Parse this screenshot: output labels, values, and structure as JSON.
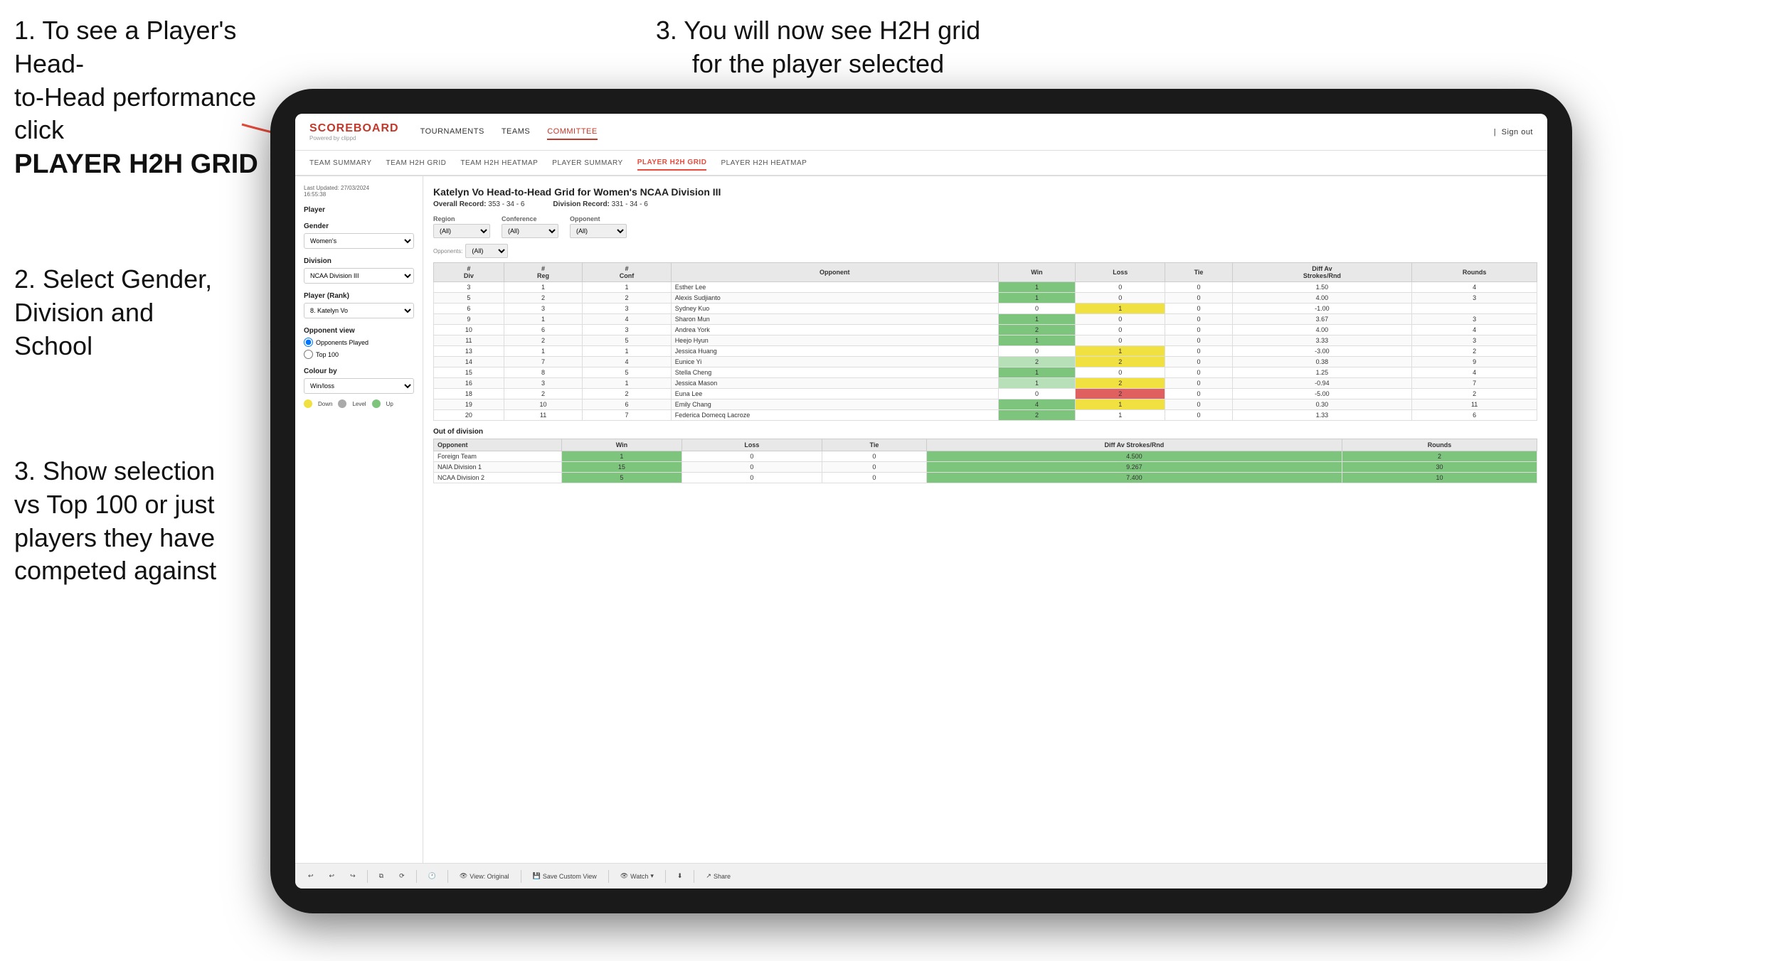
{
  "instructions": {
    "step1_line1": "1. To see a Player's Head-",
    "step1_line2": "to-Head performance click",
    "step1_bold": "PLAYER H2H GRID",
    "step3_top_line1": "3. You will now see H2H grid",
    "step3_top_line2": "for the player selected",
    "step2_line1": "2. Select Gender,",
    "step2_line2": "Division and",
    "step2_line3": "School",
    "step3_bot_line1": "3. Show selection",
    "step3_bot_line2": "vs Top 100 or just",
    "step3_bot_line3": "players they have",
    "step3_bot_line4": "competed against"
  },
  "nav": {
    "logo": "SCOREBOARD",
    "logo_sub": "Powered by clippd",
    "items": [
      "TOURNAMENTS",
      "TEAMS",
      "COMMITTEE"
    ],
    "active_item": "COMMITTEE",
    "sign_out": "Sign out"
  },
  "sub_nav": {
    "items": [
      "TEAM SUMMARY",
      "TEAM H2H GRID",
      "TEAM H2H HEATMAP",
      "PLAYER SUMMARY",
      "PLAYER H2H GRID",
      "PLAYER H2H HEATMAP"
    ],
    "active": "PLAYER H2H GRID"
  },
  "sidebar": {
    "last_updated": "Last Updated: 27/03/2024",
    "time": "16:55:38",
    "player_label": "Player",
    "gender_label": "Gender",
    "gender_value": "Women's",
    "division_label": "Division",
    "division_value": "NCAA Division III",
    "player_rank_label": "Player (Rank)",
    "player_rank_value": "8. Katelyn Vo",
    "opponent_view_label": "Opponent view",
    "radio1": "Opponents Played",
    "radio2": "Top 100",
    "colour_by_label": "Colour by",
    "colour_by_value": "Win/loss",
    "legend_down": "Down",
    "legend_level": "Level",
    "legend_up": "Up"
  },
  "grid": {
    "title": "Katelyn Vo Head-to-Head Grid for Women's NCAA Division III",
    "overall_record_label": "Overall Record:",
    "overall_record": "353 - 34 - 6",
    "division_record_label": "Division Record:",
    "division_record": "331 - 34 - 6",
    "filters": {
      "region_label": "Region",
      "conference_label": "Conference",
      "opponent_label": "Opponent",
      "opponents_label": "Opponents:",
      "region_value": "(All)",
      "conference_value": "(All)",
      "opponent_value": "(All)"
    },
    "table_headers": [
      "#\nDiv",
      "#\nReg",
      "#\nConf",
      "Opponent",
      "Win",
      "Loss",
      "Tie",
      "Diff Av\nStrokes/Rnd",
      "Rounds"
    ],
    "rows": [
      {
        "div": 3,
        "reg": 1,
        "conf": 1,
        "opponent": "Esther Lee",
        "win": 1,
        "loss": 0,
        "tie": 0,
        "diff": 1.5,
        "rounds": 4,
        "win_color": "green",
        "loss_color": "",
        "tie_color": ""
      },
      {
        "div": 5,
        "reg": 2,
        "conf": 2,
        "opponent": "Alexis Sudjianto",
        "win": 1,
        "loss": 0,
        "tie": 0,
        "diff": 4.0,
        "rounds": 3,
        "win_color": "green",
        "loss_color": "",
        "tie_color": ""
      },
      {
        "div": 6,
        "reg": 3,
        "conf": 3,
        "opponent": "Sydney Kuo",
        "win": 0,
        "loss": 1,
        "tie": 0,
        "diff": -1.0,
        "rounds": "",
        "win_color": "",
        "loss_color": "yellow",
        "tie_color": ""
      },
      {
        "div": 9,
        "reg": 1,
        "conf": 4,
        "opponent": "Sharon Mun",
        "win": 1,
        "loss": 0,
        "tie": 0,
        "diff": 3.67,
        "rounds": 3,
        "win_color": "green",
        "loss_color": "",
        "tie_color": ""
      },
      {
        "div": 10,
        "reg": 6,
        "conf": 3,
        "opponent": "Andrea York",
        "win": 2,
        "loss": 0,
        "tie": 0,
        "diff": 4.0,
        "rounds": 4,
        "win_color": "green",
        "loss_color": "",
        "tie_color": ""
      },
      {
        "div": 11,
        "reg": 2,
        "conf": 5,
        "opponent": "Heejo Hyun",
        "win": 1,
        "loss": 0,
        "tie": 0,
        "diff": 3.33,
        "rounds": 3,
        "win_color": "green",
        "loss_color": "",
        "tie_color": ""
      },
      {
        "div": 13,
        "reg": 1,
        "conf": 1,
        "opponent": "Jessica Huang",
        "win": 0,
        "loss": 1,
        "tie": 0,
        "diff": -3.0,
        "rounds": 2,
        "win_color": "",
        "loss_color": "yellow",
        "tie_color": ""
      },
      {
        "div": 14,
        "reg": 7,
        "conf": 4,
        "opponent": "Eunice Yi",
        "win": 2,
        "loss": 2,
        "tie": 0,
        "diff": 0.38,
        "rounds": 9,
        "win_color": "lightgreen",
        "loss_color": "yellow",
        "tie_color": ""
      },
      {
        "div": 15,
        "reg": 8,
        "conf": 5,
        "opponent": "Stella Cheng",
        "win": 1,
        "loss": 0,
        "tie": 0,
        "diff": 1.25,
        "rounds": 4,
        "win_color": "green",
        "loss_color": "",
        "tie_color": ""
      },
      {
        "div": 16,
        "reg": 3,
        "conf": 1,
        "opponent": "Jessica Mason",
        "win": 1,
        "loss": 2,
        "tie": 0,
        "diff": -0.94,
        "rounds": 7,
        "win_color": "lightgreen",
        "loss_color": "yellow",
        "tie_color": ""
      },
      {
        "div": 18,
        "reg": 2,
        "conf": 2,
        "opponent": "Euna Lee",
        "win": 0,
        "loss": 2,
        "tie": 0,
        "diff": -5.0,
        "rounds": 2,
        "win_color": "",
        "loss_color": "red",
        "tie_color": ""
      },
      {
        "div": 19,
        "reg": 10,
        "conf": 6,
        "opponent": "Emily Chang",
        "win": 4,
        "loss": 1,
        "tie": 0,
        "diff": 0.3,
        "rounds": 11,
        "win_color": "green",
        "loss_color": "yellow",
        "tie_color": ""
      },
      {
        "div": 20,
        "reg": 11,
        "conf": 7,
        "opponent": "Federica Domecq Lacroze",
        "win": 2,
        "loss": 1,
        "tie": 0,
        "diff": 1.33,
        "rounds": 6,
        "win_color": "green",
        "loss_color": "lightgreen",
        "tie_color": ""
      }
    ],
    "out_of_division_label": "Out of division",
    "out_of_division_rows": [
      {
        "opponent": "Foreign Team",
        "win": 1,
        "loss": 0,
        "tie": 0,
        "diff": 4.5,
        "rounds": 2
      },
      {
        "opponent": "NAIA Division 1",
        "win": 15,
        "loss": 0,
        "tie": 0,
        "diff": 9.267,
        "rounds": 30
      },
      {
        "opponent": "NCAA Division 2",
        "win": 5,
        "loss": 0,
        "tie": 0,
        "diff": 7.4,
        "rounds": 10
      }
    ]
  },
  "toolbar": {
    "view_original": "View: Original",
    "save_custom_view": "Save Custom View",
    "watch": "Watch",
    "share": "Share"
  }
}
